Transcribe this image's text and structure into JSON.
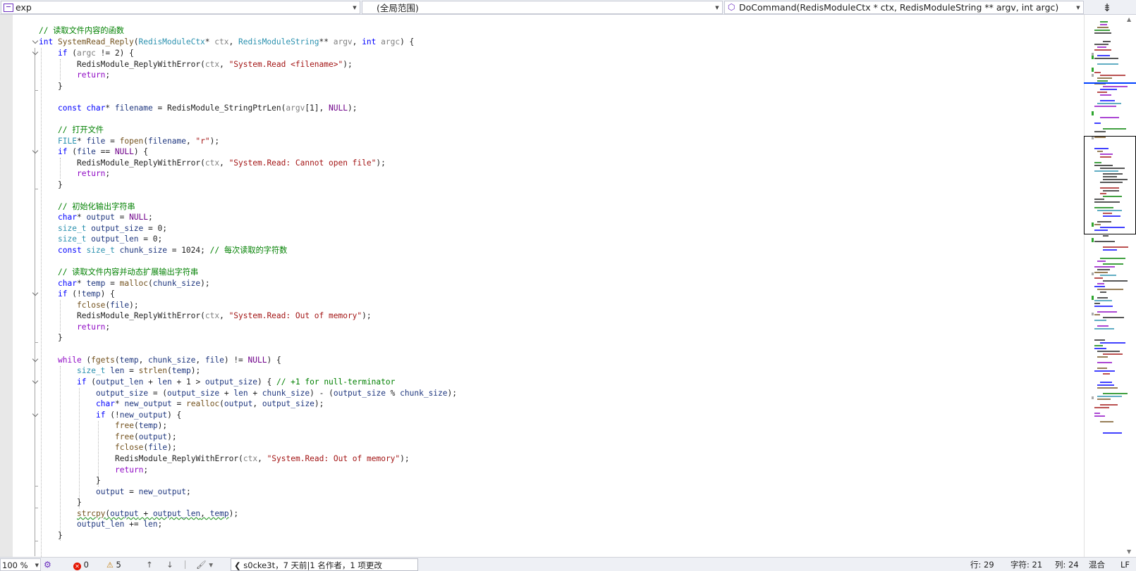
{
  "navbar": {
    "project": "exp",
    "scope": "(全局范围)",
    "member": "DoCommand(RedisModuleCtx * ctx, RedisModuleString ** argv, int argc)"
  },
  "code": {
    "comment_read_func": "// 读取文件内容的函数",
    "comment_open": "// 打开文件",
    "comment_init": "// 初始化输出字符串",
    "comment_chars": "// 每次读取的字符数",
    "comment_expand": "// 读取文件内容并动态扩展输出字符串",
    "comment_null_term": "// +1 for null-terminator",
    "str_usage": "\"System.Read <filename>\"",
    "str_cannot_open": "\"System.Read: Cannot open file\"",
    "str_oom": "\"System.Read: Out of memory\"",
    "str_mode": "\"r\"",
    "chunk_value": "1024"
  },
  "statusbar": {
    "zoom": "100 %",
    "errors": "0",
    "warnings": "5",
    "git": "s0cke3t，7 天前|1 名作者，1 项更改",
    "line": "行: 29",
    "char": "字符: 21",
    "col": "列: 24",
    "mixed": "混合",
    "eol": "LF"
  },
  "icons": {
    "error": "error-icon",
    "warning": "warning-icon",
    "up": "arrow-up-icon",
    "down": "arrow-down-icon",
    "brush": "code-cleanup-icon",
    "split": "split-window-icon"
  }
}
